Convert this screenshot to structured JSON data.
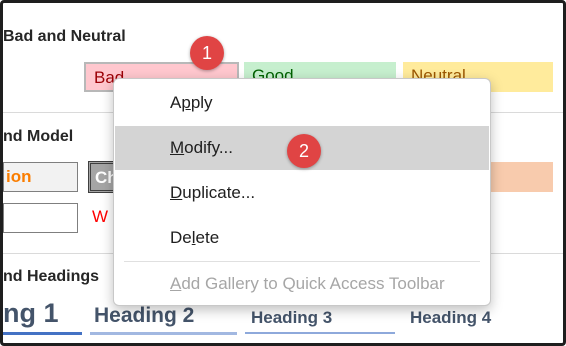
{
  "sections": {
    "good_bad_title": "Bad and Neutral",
    "data_model_title": "nd Model",
    "headings_title": "nd Headings"
  },
  "styles_row1": {
    "bad": "Bad",
    "good": "Good",
    "neutral": "Neutral"
  },
  "styles_row2": {
    "calc": "ion",
    "check": "Ch"
  },
  "styles_row3": {
    "warning": "W"
  },
  "headings": {
    "h1": "ng 1",
    "h2": "Heading 2",
    "h3": "Heading 3",
    "h4": "Heading 4"
  },
  "context_menu": {
    "apply": {
      "acc": "",
      "pre": "A",
      "u": "p",
      "post": "ply"
    },
    "modify": {
      "pre": "",
      "u": "M",
      "post": "odify..."
    },
    "duplicate": {
      "pre": "",
      "u": "D",
      "post": "uplicate..."
    },
    "delete": {
      "pre": "De",
      "u": "l",
      "post": "ete"
    },
    "add_gallery": {
      "pre": "",
      "u": "A",
      "post": "dd Gallery to Quick Access Toolbar"
    }
  },
  "badges": {
    "step1": "1",
    "step2": "2"
  },
  "colors": {
    "bad_bg": "#ffc7ce",
    "bad_text": "#9c0006",
    "good_bg": "#c6efce",
    "good_text": "#006100",
    "neutral_bg": "#ffeb9c",
    "neutral_text": "#9c5700",
    "calc_text": "#fa7d00",
    "warning_text": "#ff0000",
    "heading_text": "#44546a",
    "badge_red": "#e04444"
  }
}
